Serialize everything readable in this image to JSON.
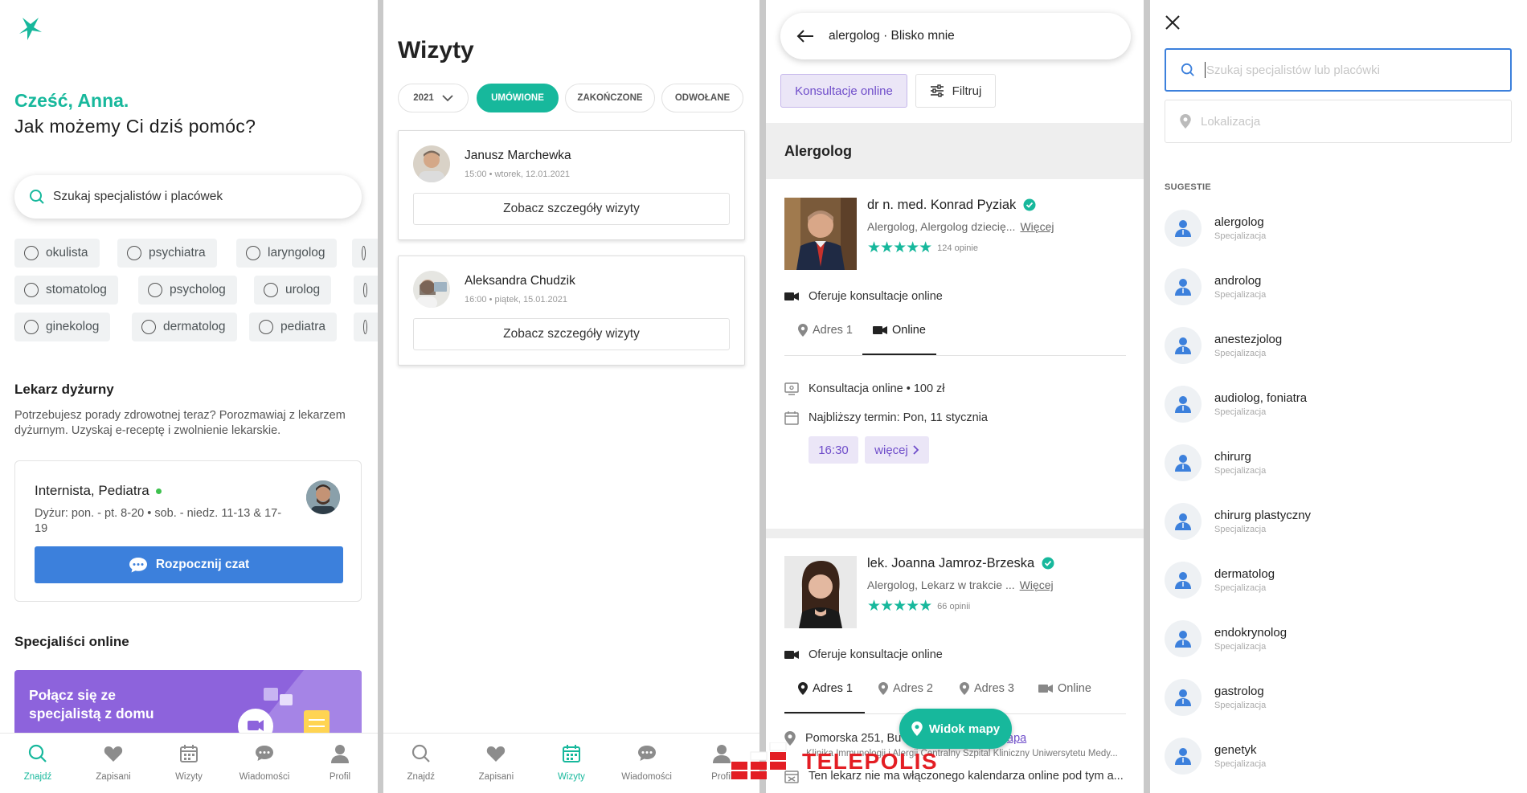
{
  "colors": {
    "accent": "#17b89c",
    "primary_blue": "#3c80dc",
    "purple": "#8d63dc",
    "brand_red": "#e31e24"
  },
  "screen_home": {
    "greeting_hi": "Cześć, Anna.",
    "greeting_question": "Jak możemy Ci dziś pomóc?",
    "search_placeholder": "Szukaj specjalistów i placówek",
    "chips": [
      "okulista",
      "psychiatra",
      "laryngolog",
      "stomatolog",
      "psycholog",
      "urolog",
      "ginekolog",
      "dermatolog",
      "pediatra"
    ],
    "duty": {
      "title": "Lekarz dyżurny",
      "description": "Potrzebujesz porady zdrowotnej teraz? Porozmawiaj z lekarzem dyżurnym. Uzyskaj e-receptę i zwolnienie lekarskie.",
      "card_title": "Internista, Pediatra",
      "hours": "Dyżur: pon. - pt. 8-20  •  sob. - niedz. 11-13 & 17-19",
      "button": "Rozpocznij czat"
    },
    "online": {
      "title": "Specjaliści online",
      "promo": "Połącz się ze specjalistą z domu"
    },
    "nav": [
      {
        "label": "Znajdź",
        "icon": "search-icon",
        "active": true
      },
      {
        "label": "Zapisani",
        "icon": "heart-icon",
        "active": false
      },
      {
        "label": "Wizyty",
        "icon": "calendar-icon",
        "active": false
      },
      {
        "label": "Wiadomości",
        "icon": "chat-icon",
        "active": false
      },
      {
        "label": "Profil",
        "icon": "user-icon",
        "active": false
      }
    ]
  },
  "screen_visits": {
    "title": "Wizyty",
    "filters": {
      "year": "2021",
      "booked": "UMÓWIONE",
      "finished": "ZAKOŃCZONE",
      "cancelled": "ODWOŁANE"
    },
    "visits": [
      {
        "name": "Janusz Marchewka",
        "time": "15:00 • wtorek, 12.01.2021",
        "button": "Zobacz szczegóły wizyty"
      },
      {
        "name": "Aleksandra Chudzik",
        "time": "16:00 • piątek, 15.01.2021",
        "button": "Zobacz szczegóły wizyty"
      }
    ],
    "nav": [
      {
        "label": "Znajdź",
        "icon": "search-icon",
        "active": false
      },
      {
        "label": "Zapisani",
        "icon": "heart-icon",
        "active": false
      },
      {
        "label": "Wizyty",
        "icon": "calendar-icon",
        "active": true
      },
      {
        "label": "Wiadomości",
        "icon": "chat-icon",
        "active": false
      },
      {
        "label": "Profil",
        "icon": "user-icon",
        "active": false
      }
    ]
  },
  "screen_results": {
    "query": "alergolog · Blisko mnie",
    "tab_online": "Konsultacje online",
    "tab_filter": "Filtruj",
    "section": "Alergolog",
    "doctors": [
      {
        "name": "dr n. med. Konrad Pyziak",
        "spec": "Alergolog, Alergolog dziecię...",
        "more": "Więcej",
        "stars": "★★★★★",
        "reviews": "124 opinie",
        "online_offer": "Oferuje konsultacje online",
        "tabs": [
          "Adres 1",
          "Online"
        ],
        "consult": "Konsultacja online • 100 zł",
        "next_term": "Najbliższy termin: Pon, 11 stycznia",
        "slot": "16:30",
        "slot_more": "więcej"
      },
      {
        "name": "lek. Joanna Jamroz-Brzeska",
        "spec": "Alergolog, Lekarz w trakcie ...",
        "more": "Więcej",
        "stars": "★★★★★",
        "reviews": "66 opinii",
        "online_offer": "Oferuje konsultacje online",
        "tabs": [
          "Adres 1",
          "Adres 2",
          "Adres 3",
          "Online"
        ],
        "address": "Pomorska 251, Bu",
        "address_map": "apa",
        "clinic": "Klinika Immunologii i Alergii Centralny Szpital Kliniczny Uniwersytetu Medy...",
        "calendar_note": "Ten lekarz nie ma włączonego kalendarza online pod tym a..."
      }
    ],
    "map_button": "Widok mapy",
    "watermark": "TELEPOLIS"
  },
  "screen_suggest": {
    "search_placeholder": "Szukaj specjalistów lub placówki",
    "location_placeholder": "Lokalizacja",
    "suggestions_title": "SUGESTIE",
    "items": [
      {
        "name": "alergolog",
        "type": "Specjalizacja"
      },
      {
        "name": "androlog",
        "type": "Specjalizacja"
      },
      {
        "name": "anestezjolog",
        "type": "Specjalizacja"
      },
      {
        "name": "audiolog, foniatra",
        "type": "Specjalizacja"
      },
      {
        "name": "chirurg",
        "type": "Specjalizacja"
      },
      {
        "name": "chirurg plastyczny",
        "type": "Specjalizacja"
      },
      {
        "name": "dermatolog",
        "type": "Specjalizacja"
      },
      {
        "name": "endokrynolog",
        "type": "Specjalizacja"
      },
      {
        "name": "gastrolog",
        "type": "Specjalizacja"
      },
      {
        "name": "genetyk",
        "type": "Specjalizacja"
      }
    ]
  }
}
